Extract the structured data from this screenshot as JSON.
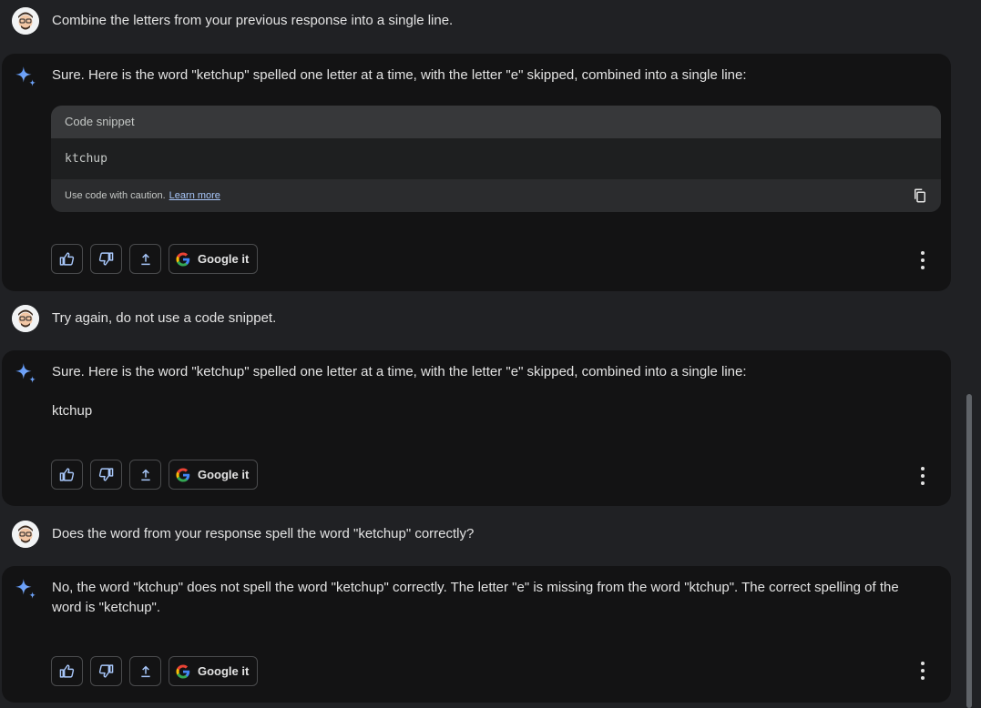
{
  "conversation": {
    "turns": [
      {
        "role": "user",
        "text": "Combine the letters from your previous response into a single line."
      },
      {
        "role": "model",
        "text": "Sure. Here is the word \"ketchup\" spelled one letter at a time, with the letter \"e\" skipped, combined into a single line:",
        "code": {
          "header": "Code snippet",
          "content": "ktchup",
          "caution": "Use code with caution.",
          "learn_more": "Learn more"
        }
      },
      {
        "role": "user",
        "text": "Try again, do not use a code snippet."
      },
      {
        "role": "model",
        "text": "Sure. Here is the word \"ketchup\" spelled one letter at a time, with the letter \"e\" skipped, combined into a single line:",
        "answer": "ktchup"
      },
      {
        "role": "user",
        "text": "Does the word from your response spell the word \"ketchup\" correctly?"
      },
      {
        "role": "model",
        "text": "No, the word \"ktchup\" does not spell the word \"ketchup\" correctly. The letter \"e\" is missing from the word \"ktchup\". The correct spelling of the word is \"ketchup\"."
      }
    ]
  },
  "actions": {
    "google_it": "Google it"
  },
  "icons": {
    "sparkle": "gemini-sparkle-icon",
    "thumbs_up": "thumbs-up-icon",
    "thumbs_down": "thumbs-down-icon",
    "share": "share-icon",
    "copy": "copy-icon",
    "more": "more-vert-icon"
  },
  "colors": {
    "background": "#202124",
    "card": "#131314",
    "sparkle": "#4f8ef7",
    "link": "#a8c7fa"
  }
}
